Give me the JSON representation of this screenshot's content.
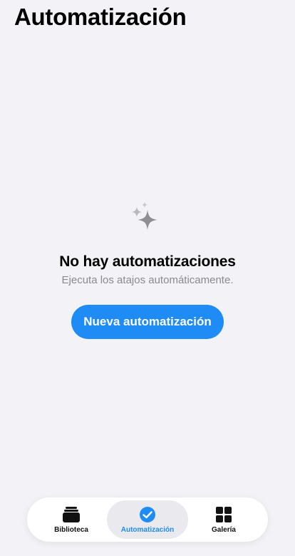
{
  "header": {
    "title": "Automatización"
  },
  "empty_state": {
    "icon": "sparkles-icon",
    "title": "No hay automatizaciones",
    "subtitle": "Ejecuta los atajos automáticamente.",
    "button_label": "Nueva automatización"
  },
  "tabbar": {
    "selected": "Automatización",
    "tabs": [
      {
        "label": "Biblioteca",
        "icon": "stack-icon"
      },
      {
        "label": "Automatización",
        "icon": "checkmark-clock-icon"
      },
      {
        "label": "Galería",
        "icon": "grid-icon"
      }
    ]
  },
  "colors": {
    "accent": "#1f8bf5",
    "background": "#f2f2f7",
    "secondary_text": "#8a8a8e"
  }
}
